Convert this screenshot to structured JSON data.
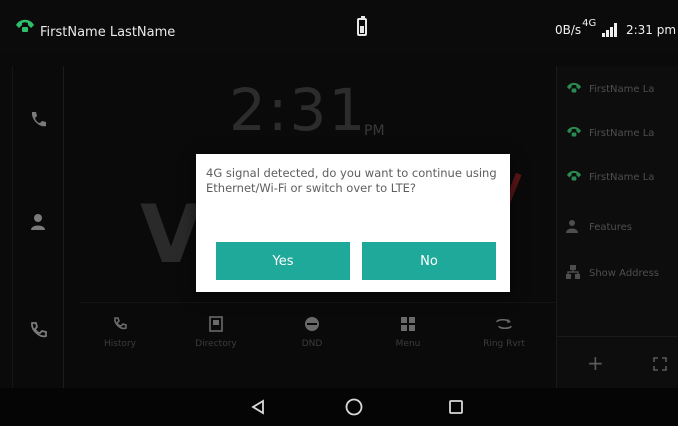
{
  "status_bar": {
    "user_name": "FirstName LastName",
    "network_speed": "0B/s",
    "network_type": "4G",
    "time": "2:31 pm",
    "accent_color": "#1fa99a"
  },
  "left_rail": {
    "items": [
      {
        "icon": "phone-icon"
      },
      {
        "icon": "contact-icon"
      },
      {
        "icon": "call-history-icon"
      }
    ]
  },
  "main": {
    "clock_time": "2:31",
    "clock_ampm": "PM",
    "brand_letter": "V",
    "shortcuts": [
      {
        "label": "History",
        "icon": "history-icon"
      },
      {
        "label": "Directory",
        "icon": "directory-icon"
      },
      {
        "label": "DND",
        "icon": "dnd-icon"
      },
      {
        "label": "Menu",
        "icon": "menu-grid-icon"
      },
      {
        "label": "Ring Rvrt",
        "icon": "redial-icon"
      }
    ]
  },
  "right_panel": {
    "line_keys": [
      {
        "label": "FirstName La",
        "icon": "line-phone-icon"
      },
      {
        "label": "FirstName La",
        "icon": "line-phone-icon"
      },
      {
        "label": "FirstName La",
        "icon": "line-phone-icon"
      },
      {
        "label": "Features",
        "icon": "features-icon"
      },
      {
        "label": "Show Address",
        "icon": "network-icon"
      }
    ],
    "footer": {
      "add_label": "+"
    }
  },
  "dialog": {
    "message": "4G signal detected, do you want to continue using Ethernet/Wi-Fi or switch over to LTE?",
    "yes_label": "Yes",
    "no_label": "No"
  }
}
